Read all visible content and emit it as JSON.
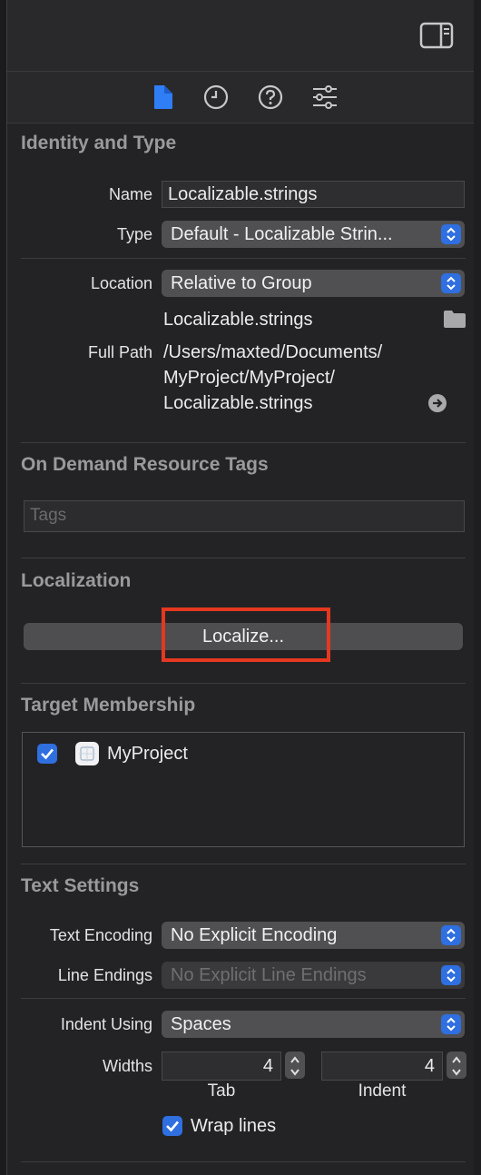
{
  "tabs": [
    {
      "icon": "file-inspector-icon"
    },
    {
      "icon": "history-inspector-icon"
    },
    {
      "icon": "quick-help-icon"
    },
    {
      "icon": "attributes-inspector-icon"
    }
  ],
  "identity": {
    "title": "Identity and Type",
    "name_label": "Name",
    "name_value": "Localizable.strings",
    "type_label": "Type",
    "type_value": "Default - Localizable Strin...",
    "location_label": "Location",
    "location_value": "Relative to Group",
    "file_name": "Localizable.strings",
    "full_path_label": "Full Path",
    "full_path_line1": "/Users/maxted/Documents/",
    "full_path_line2": "MyProject/MyProject/",
    "full_path_line3": "Localizable.strings"
  },
  "odr": {
    "title": "On Demand Resource Tags",
    "tags_placeholder": "Tags"
  },
  "localization": {
    "title": "Localization",
    "localize_label": "Localize..."
  },
  "membership": {
    "title": "Target Membership",
    "targets": [
      {
        "name": "MyProject",
        "checked": true
      }
    ]
  },
  "text_settings": {
    "title": "Text Settings",
    "encoding_label": "Text Encoding",
    "encoding_value": "No Explicit Encoding",
    "line_endings_label": "Line Endings",
    "line_endings_value": "No Explicit Line Endings",
    "indent_label": "Indent Using",
    "indent_value": "Spaces",
    "widths_label": "Widths",
    "tab_width": "4",
    "indent_width": "4",
    "tab_caption": "Tab",
    "indent_caption": "Indent",
    "wrap_label": "Wrap lines",
    "wrap_checked": true
  },
  "colors": {
    "accent": "#2f6fe0",
    "highlight": "#e53820",
    "background": "#232325"
  }
}
